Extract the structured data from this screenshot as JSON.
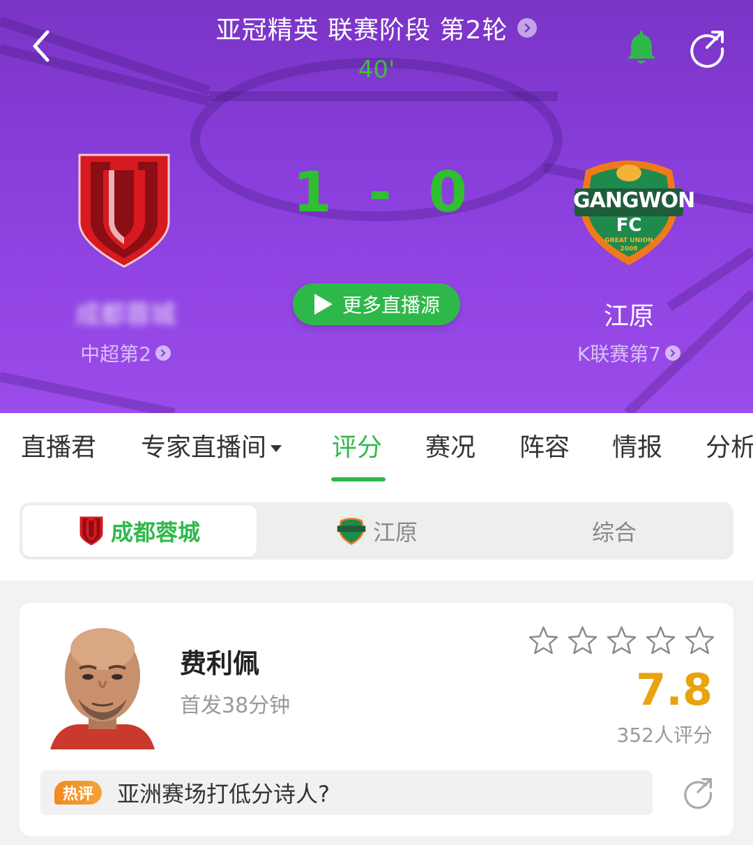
{
  "header": {
    "title": "亚冠精英 联赛阶段 第2轮",
    "minute": "40'",
    "score": {
      "home": "1",
      "separator": "-",
      "away": "0"
    },
    "live_button_label": "更多直播源",
    "home_team": {
      "name": "成都蓉城",
      "rank": "中超第2"
    },
    "away_team": {
      "name": "江原",
      "rank": "K联赛第7"
    },
    "away_logo_text": {
      "line1": "GANGWON",
      "line2": "FC",
      "line3": "GREAT UNION",
      "line4": "2008"
    },
    "colors": {
      "bg_top": "#7a34c6",
      "bg_bottom": "#9b4ceb",
      "score": "#2fbf2f",
      "bell": "#2fb84a"
    }
  },
  "tabs": [
    {
      "label": "直播君"
    },
    {
      "label": "专家直播间"
    },
    {
      "label": "评分",
      "active": true
    },
    {
      "label": "赛况"
    },
    {
      "label": "阵容"
    },
    {
      "label": "情报"
    },
    {
      "label": "分析"
    }
  ],
  "team_selector": {
    "home": "成都蓉城",
    "away": "江原",
    "overall": "综合",
    "selected": "home"
  },
  "player_card": {
    "name": "费利佩",
    "detail": "首发38分钟",
    "stars_filled": 0,
    "stars_total": 5,
    "rating": "7.8",
    "raters": "352人评分",
    "hot_comment_badge": "热评",
    "hot_comment": "亚洲赛场打低分诗人?"
  },
  "icons": [
    "back-icon",
    "chevron-right-icon",
    "bell-icon",
    "share-icon",
    "play-icon",
    "star-icon"
  ]
}
